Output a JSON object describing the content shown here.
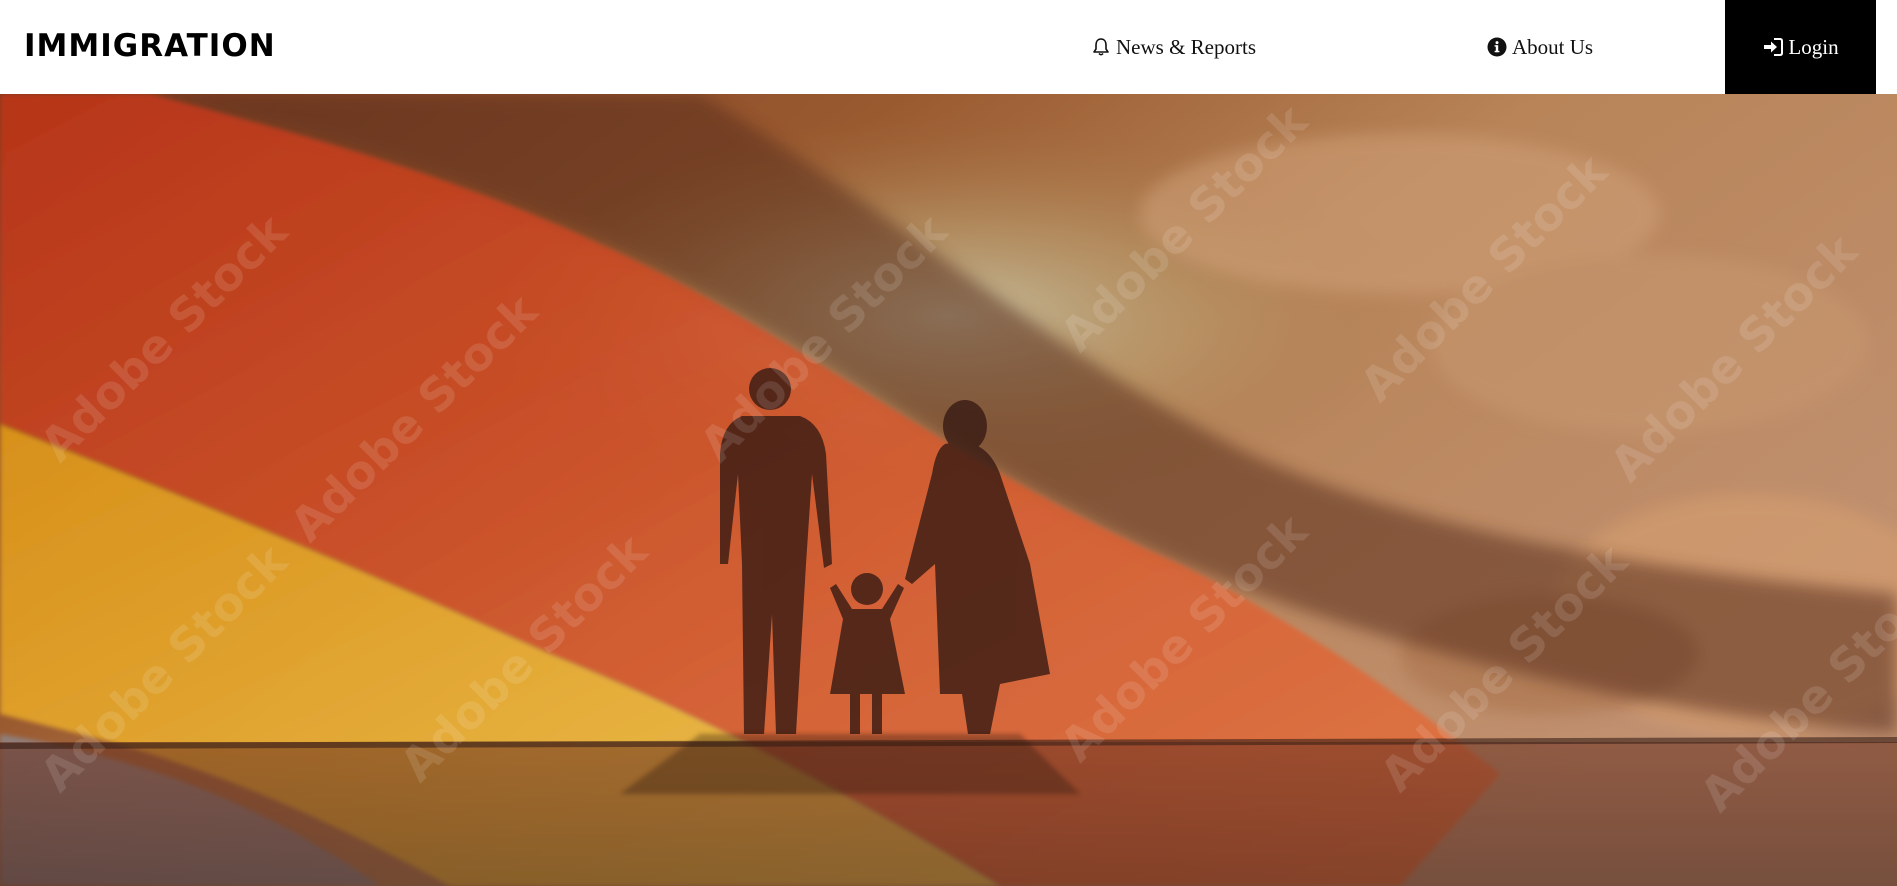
{
  "brand": {
    "title": "IMMIGRATION"
  },
  "nav": {
    "items": [
      {
        "label": "News & Reports",
        "icon": "bell-icon"
      },
      {
        "label": "About Us",
        "icon": "info-circle-icon"
      }
    ],
    "login": {
      "label": "Login",
      "icon": "sign-in-icon"
    }
  },
  "hero": {
    "image": "family-silhouette-flag-sunset",
    "watermark": "Adobe Stock"
  },
  "colors": {
    "navbar_bg": "#ffffff",
    "login_bg": "#000000",
    "login_text": "#ffffff",
    "flag_red": "#d9481e",
    "flag_gold": "#f0b020"
  }
}
